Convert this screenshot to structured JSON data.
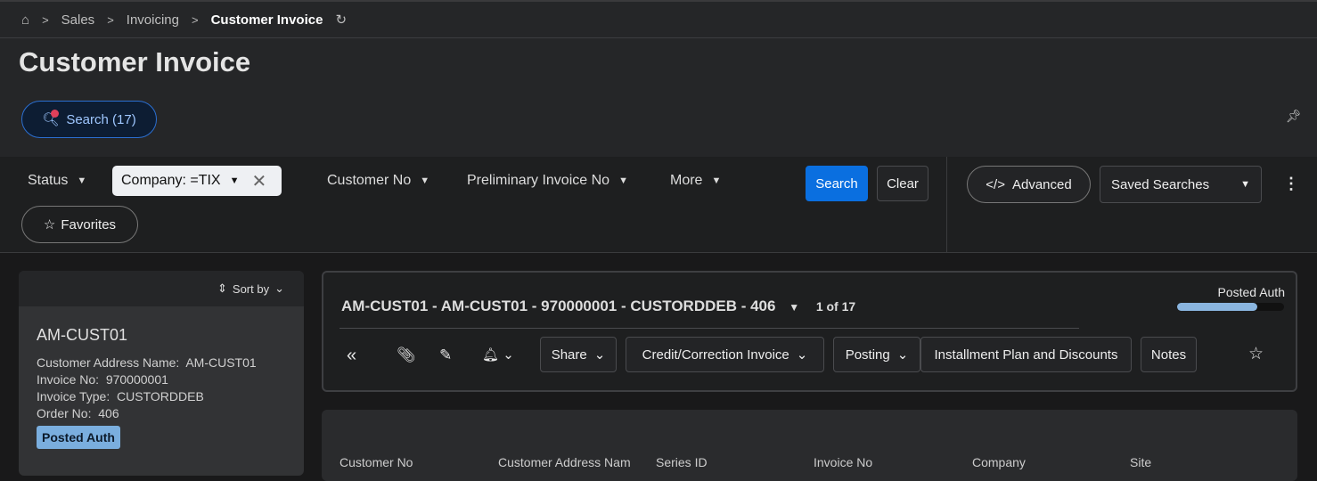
{
  "breadcrumb": {
    "items": [
      "Sales",
      "Invoicing"
    ],
    "current": "Customer Invoice"
  },
  "page": {
    "title": "Customer Invoice"
  },
  "search_button": "Search (17)",
  "filters": {
    "status": "Status",
    "company": "Company: =TIX",
    "customer_no": "Customer No",
    "preliminary_invoice_no": "Preliminary Invoice No",
    "more": "More",
    "search": "Search",
    "clear": "Clear",
    "advanced": "Advanced",
    "saved_searches": "Saved Searches",
    "favorites": "Favorites"
  },
  "list": {
    "sort_by": "Sort by",
    "card": {
      "title": "AM-CUST01",
      "fields": [
        {
          "label": "Customer Address Name:",
          "value": "AM-CUST01"
        },
        {
          "label": "Invoice No:",
          "value": "970000001"
        },
        {
          "label": "Invoice Type:",
          "value": "CUSTORDDEB"
        },
        {
          "label": "Order No:",
          "value": "406"
        }
      ],
      "status": "Posted Auth"
    }
  },
  "detail": {
    "header": "AM-CUST01 - AM-CUST01 - 970000001 - CUSTORDDEB - 406",
    "pager": "1 of 17",
    "status": "Posted Auth",
    "progress_percent": 75,
    "toolbar": {
      "share": "Share",
      "credit": "Credit/Correction Invoice",
      "posting": "Posting",
      "installment": "Installment Plan and Discounts",
      "notes": "Notes"
    }
  },
  "grid": {
    "columns": [
      "Customer No",
      "Customer Address Name",
      "Series ID",
      "Invoice No",
      "Company",
      "Site"
    ]
  },
  "colors": {
    "accent": "#0a6fe0",
    "badge": "#7aaede"
  }
}
